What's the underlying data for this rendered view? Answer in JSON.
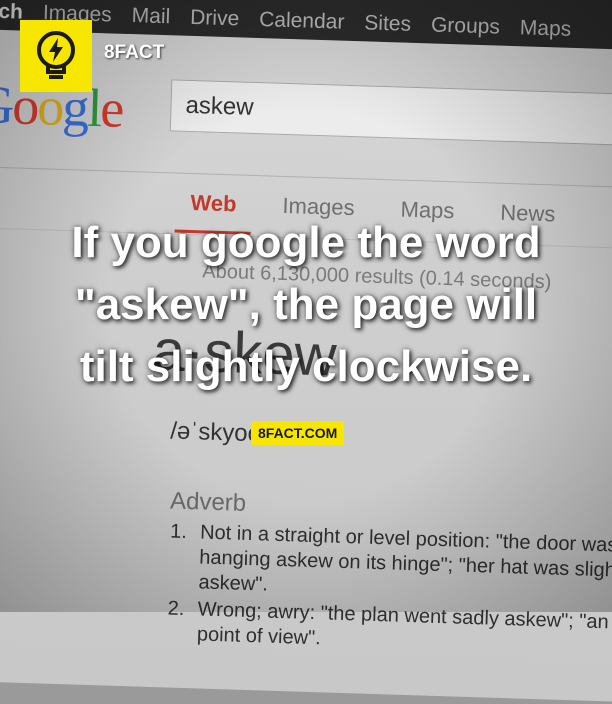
{
  "topbar": {
    "items": [
      "ch",
      "Images",
      "Mail",
      "Drive",
      "Calendar",
      "Sites",
      "Groups",
      "Maps"
    ]
  },
  "google_logo_text": "Google",
  "search": {
    "query": "askew"
  },
  "result_tabs": [
    {
      "label": "Web",
      "active": true
    },
    {
      "label": "Images",
      "active": false
    },
    {
      "label": "Maps",
      "active": false
    },
    {
      "label": "News",
      "active": false
    }
  ],
  "result_stats": "About 6,130,000 results (0.14 seconds)",
  "dictionary": {
    "word": "a·skew",
    "pronunciation": "/əˈskyoo/",
    "part_of_speech": "Adverb",
    "definitions": [
      {
        "num": "1.",
        "text": "Not in a straight or level position: \"the door was hanging askew on its hinge\"; \"her hat was slightly askew\"."
      },
      {
        "num": "2.",
        "text": "Wrong; awry: \"the plan went sadly askew\"; \"an askew point of view\"."
      }
    ]
  },
  "branding": {
    "name": "8FACT",
    "site": "8FACT.COM",
    "accent_color": "#f7e600"
  },
  "fact": {
    "lines": [
      "If you google the word",
      "\"askew\", the page will",
      "tilt slightly clockwise."
    ]
  }
}
